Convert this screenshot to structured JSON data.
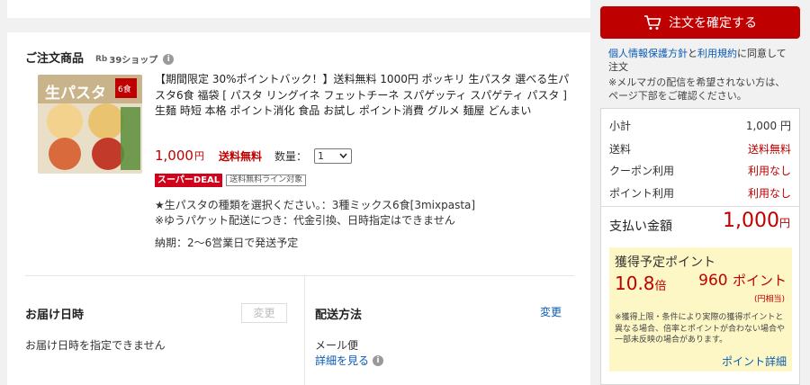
{
  "order": {
    "title": "ご注文商品",
    "shop_icon_text": "Rb",
    "shop_name": "39ショップ",
    "info_glyph": "i",
    "product": {
      "title": "【期間限定 30%ポイントバック！】送料無料 1000円 ポッキリ 生パスタ 選べる生パスタ6食 福袋 [ パスタ リングイネ フェットチーネ スパゲッティ スパゲティ パスタ ] 生麺 時短 本格 ポイント消化 食品 お試し ポイント消費 グルメ 麺屋 どんまい",
      "image_text": "生パスタ",
      "image_badge": "6食",
      "price": "1,000",
      "price_unit": "円",
      "shipping": "送料無料",
      "qty_label": "数量：",
      "qty_value": "1",
      "badge_super": "スーパーDEAL",
      "badge_ship_line": "送料無料ライン対象",
      "option1": "★生パスタの種類を選択ください。：3種ミックス6食[3mixpasta]",
      "option2": "※ゆうパケット配送につき：代金引換、日時指定はできません",
      "delivery_time": "納期：2～6営業日で発送予定"
    }
  },
  "delivery_date": {
    "title": "お届け日時",
    "change_label": "変更",
    "note": "お届け日時を指定できません"
  },
  "shipping_method": {
    "title": "配送方法",
    "change_label": "変更",
    "method": "メール便",
    "detail_link": "詳細を見る"
  },
  "sidebar": {
    "confirm_label": "注文を確定する",
    "privacy_link": "個人情報保護方針",
    "privacy_and": "と",
    "terms_link": "利用規約",
    "privacy_suffix": "に同意して注文",
    "mail_note": "※メルマガの配信を希望されない方は、ページ下部をご確認ください。",
    "summary": {
      "subtotal_label": "小計",
      "subtotal_value": "1,000 円",
      "shipping_label": "送料",
      "shipping_value": "送料無料",
      "coupon_label": "クーポン利用",
      "coupon_value": "利用なし",
      "point_label": "ポイント利用",
      "point_value": "利用なし",
      "total_label": "支払い金額",
      "total_value": "1,000",
      "total_unit": "円"
    },
    "points": {
      "title": "獲得予定ポイント",
      "rate": "10.8",
      "rate_unit": "倍",
      "points": "960",
      "points_unit": "ポイント",
      "yen_equiv": "(円相当)",
      "note": "※獲得上限・条件により実際の獲得ポイントと異なる場合、倍率とポイントが合わない場合や一部未反映の場合があります。",
      "detail_link": "ポイント詳細"
    }
  },
  "colors": {
    "accent": "#bf0000",
    "link": "#0a5ab5",
    "points_bg": "#fdf7c6"
  }
}
